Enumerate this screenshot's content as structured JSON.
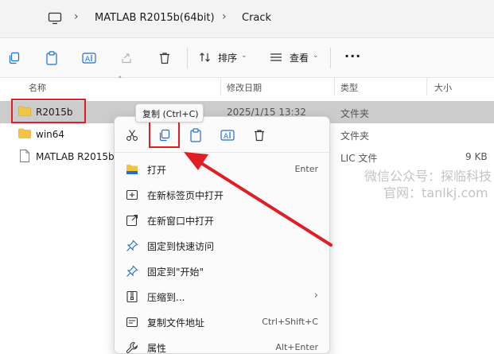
{
  "address_bar": {
    "crumbs": [
      "MATLAB R2015b(64bit)",
      "Crack"
    ]
  },
  "toolbar": {
    "sort_label": "排序",
    "view_label": "查看",
    "more_label": "···"
  },
  "columns": {
    "name": "名称",
    "modified": "修改日期",
    "type": "类型",
    "size": "大小"
  },
  "files": [
    {
      "name": "R2015b",
      "modified": "2025/1/15 13:32",
      "type": "文件夹",
      "size": "",
      "icon": "folder-icon",
      "selected": true
    },
    {
      "name": "win64",
      "modified": "",
      "type": "文件夹",
      "size": "",
      "icon": "folder-icon",
      "selected": false
    },
    {
      "name": "MATLAB R2015b",
      "modified": "",
      "type": "LIC 文件",
      "size": "9 KB",
      "icon": "file-icon",
      "selected": false
    }
  ],
  "tooltip": "复制 (Ctrl+C)",
  "context_menu": {
    "quick_actions": [
      "cut-icon",
      "copy-icon",
      "paste-icon",
      "rename-icon",
      "delete-icon"
    ],
    "items": [
      {
        "icon": "open-folder-icon",
        "label": "打开",
        "shortcut": "Enter"
      },
      {
        "icon": "new-tab-icon",
        "label": "在新标签页中打开",
        "shortcut": ""
      },
      {
        "icon": "new-window-icon",
        "label": "在新窗口中打开",
        "shortcut": ""
      },
      {
        "icon": "pin-icon",
        "label": "固定到快速访问",
        "shortcut": ""
      },
      {
        "icon": "pin-start-icon",
        "label": "固定到\"开始\"",
        "shortcut": ""
      },
      {
        "icon": "zip-icon",
        "label": "压缩到...",
        "shortcut": ""
      },
      {
        "icon": "copy-path-icon",
        "label": "复制文件地址",
        "shortcut": "Ctrl+Shift+C"
      },
      {
        "icon": "properties-icon",
        "label": "属性",
        "shortcut": "Alt+Enter"
      }
    ]
  },
  "watermark": {
    "line1": "微信公众号：探临科技",
    "line2": "官网：tanlkj.com"
  },
  "colors": {
    "highlight_red": "#e01e26",
    "folder_yellow": "#f5c342",
    "selection_gray": "#cccccc",
    "accent_blue": "#1f6fd1"
  }
}
